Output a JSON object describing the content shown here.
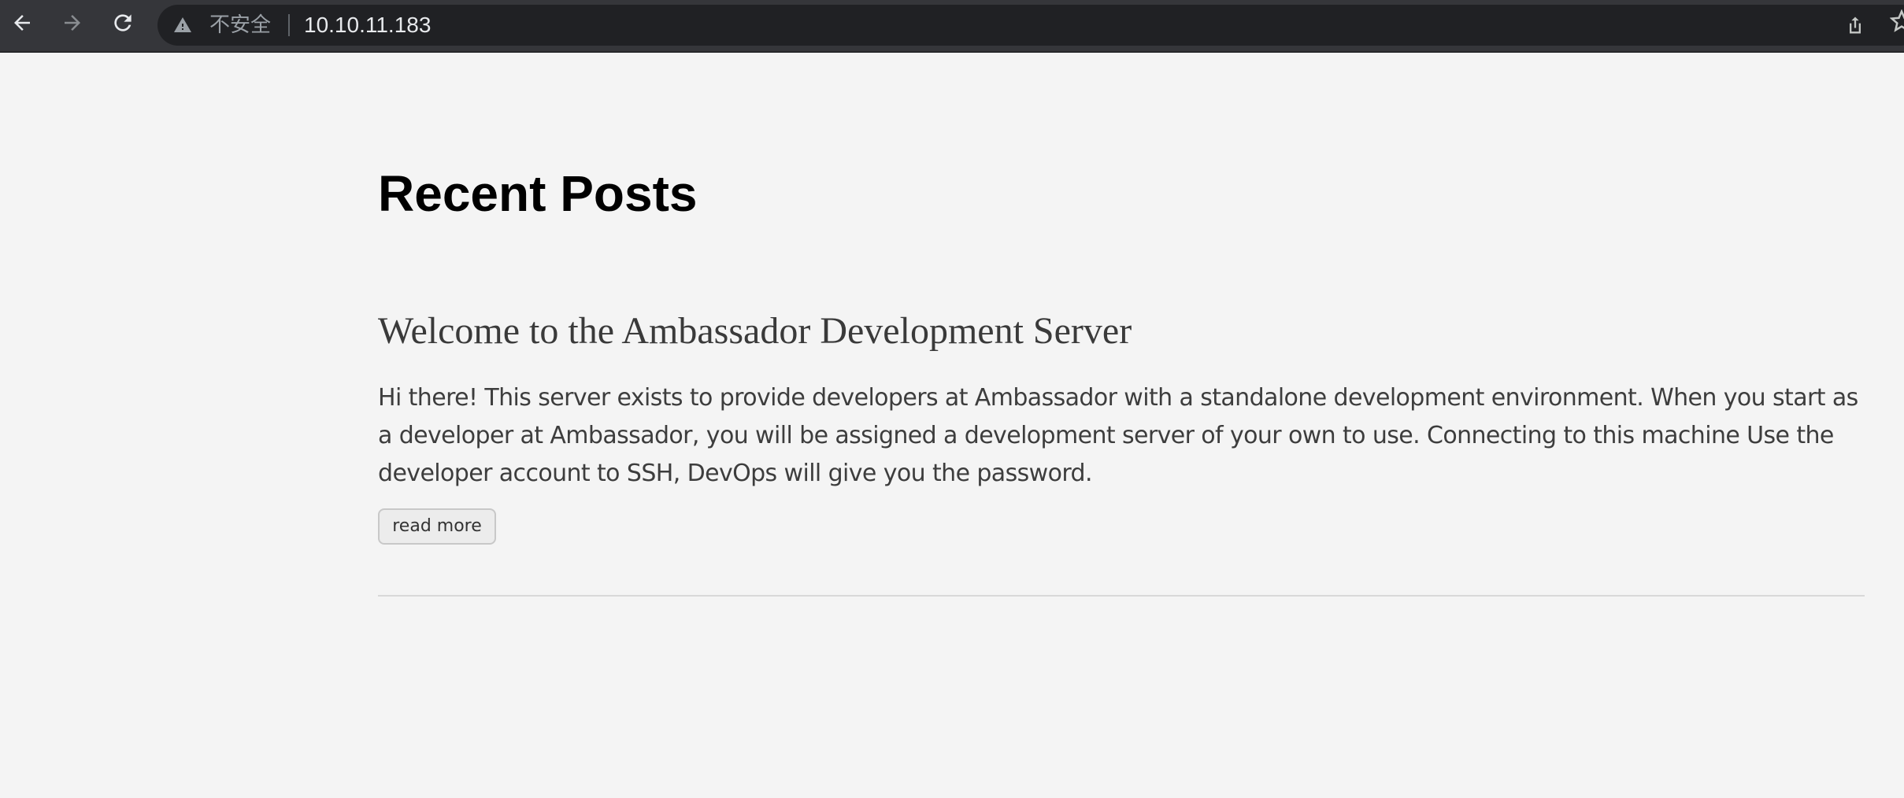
{
  "browser": {
    "security_label": "不安全",
    "url": "10.10.11.183",
    "icons": {
      "back": "arrow-left-icon",
      "forward": "arrow-right-icon",
      "reload": "reload-icon",
      "warning": "warning-triangle-icon",
      "share": "share-icon",
      "bookmark": "star-icon"
    },
    "colors": {
      "toolbar": "#35363a",
      "omnibox": "#202124",
      "url_text": "#e8eaed",
      "security_text": "#9aa0a6"
    }
  },
  "page": {
    "heading": "Recent Posts",
    "posts": [
      {
        "title": "Welcome to the Ambassador Development Server",
        "excerpt": "Hi there! This server exists to provide developers at Ambassador with a standalone development environment. When you start as a developer at Ambassador, you will be assigned a development server of your own to use. Connecting to this machine Use the developer account to SSH, DevOps will give you the password.",
        "read_more_label": "read more"
      }
    ],
    "colors": {
      "background": "#f4f4f4",
      "heading": "#000000",
      "post_title": "#3a3a3a",
      "body_text": "#3d3d3d"
    }
  }
}
